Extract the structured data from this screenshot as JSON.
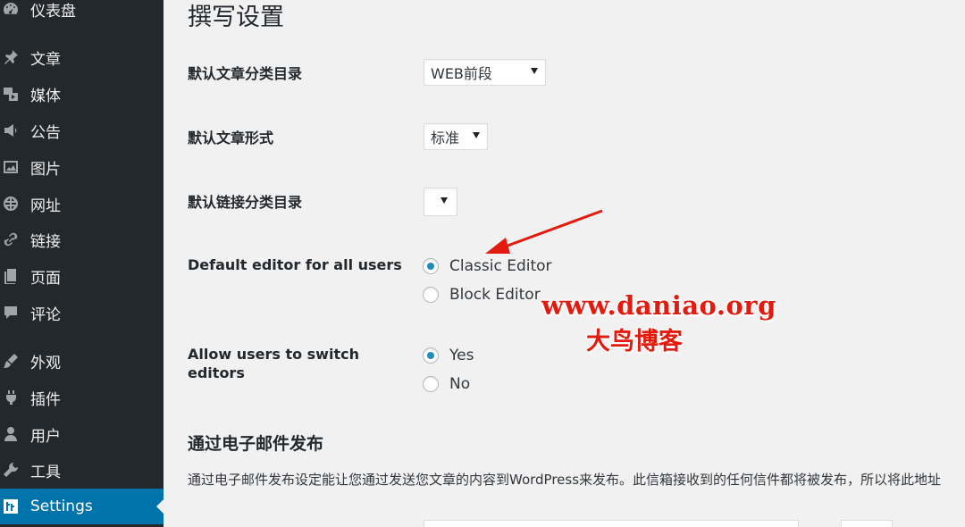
{
  "sidebar": {
    "items": [
      {
        "label": "仪表盘",
        "icon": "dashboard-icon"
      },
      {
        "label": "文章",
        "icon": "pushpin-icon"
      },
      {
        "label": "媒体",
        "icon": "media-icon"
      },
      {
        "label": "公告",
        "icon": "megaphone-icon"
      },
      {
        "label": "图片",
        "icon": "image-icon"
      },
      {
        "label": "网址",
        "icon": "globe-icon"
      },
      {
        "label": "链接",
        "icon": "link-icon"
      },
      {
        "label": "页面",
        "icon": "page-icon"
      },
      {
        "label": "评论",
        "icon": "comment-icon"
      },
      {
        "label": "外观",
        "icon": "brush-icon"
      },
      {
        "label": "插件",
        "icon": "plugin-icon"
      },
      {
        "label": "用户",
        "icon": "user-icon"
      },
      {
        "label": "工具",
        "icon": "wrench-icon"
      },
      {
        "label": "Settings",
        "icon": "settings-icon",
        "active": true
      }
    ]
  },
  "page": {
    "title": "撰写设置"
  },
  "settings": {
    "default_category_label": "默认文章分类目录",
    "default_category_value": "WEB前段",
    "default_format_label": "默认文章形式",
    "default_format_value": "标准",
    "default_link_category_label": "默认链接分类目录",
    "default_link_category_value": "",
    "default_editor_label": "Default editor for all users",
    "editor_options": [
      {
        "label": "Classic Editor",
        "checked": true
      },
      {
        "label": "Block Editor",
        "checked": false
      }
    ],
    "allow_switch_label": "Allow users to switch editors",
    "switch_options": [
      {
        "label": "Yes",
        "checked": true
      },
      {
        "label": "No",
        "checked": false
      }
    ]
  },
  "email_section": {
    "title": "通过电子邮件发布",
    "description": "通过电子邮件发布设定能让您通过发送您文章的内容到WordPress来发布。此信箱接收到的任何信件都将被发布，所以将此地址"
  },
  "watermark": {
    "url": "www.daniao.org",
    "name": "大鸟博客"
  },
  "colors": {
    "sidebar_bg": "#23282d",
    "active_bg": "#0073aa",
    "radio_checked": "#1e8cbe",
    "watermark_red": "#e31b0e",
    "annotation_arrow": "#e31b0e"
  }
}
